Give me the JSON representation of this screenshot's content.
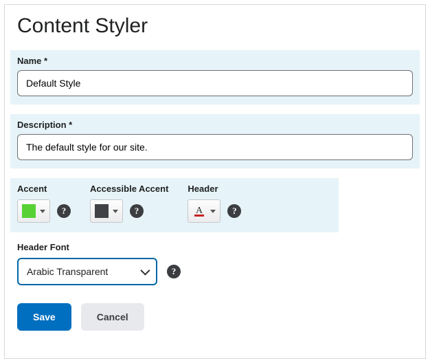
{
  "page": {
    "title": "Content Styler"
  },
  "fields": {
    "name": {
      "label": "Name",
      "required_mark": "*",
      "value": "Default Style"
    },
    "description": {
      "label": "Description",
      "required_mark": "*",
      "value": "The default style for our site."
    }
  },
  "colors": {
    "accent": {
      "label": "Accent",
      "swatch_color": "#58d134"
    },
    "accessible_accent": {
      "label": "Accessible Accent",
      "swatch_color": "#404246"
    },
    "header": {
      "label": "Header"
    }
  },
  "header_font": {
    "label": "Header Font",
    "value": "Arabic Transparent"
  },
  "buttons": {
    "save": "Save",
    "cancel": "Cancel"
  },
  "help_glyph": "?"
}
